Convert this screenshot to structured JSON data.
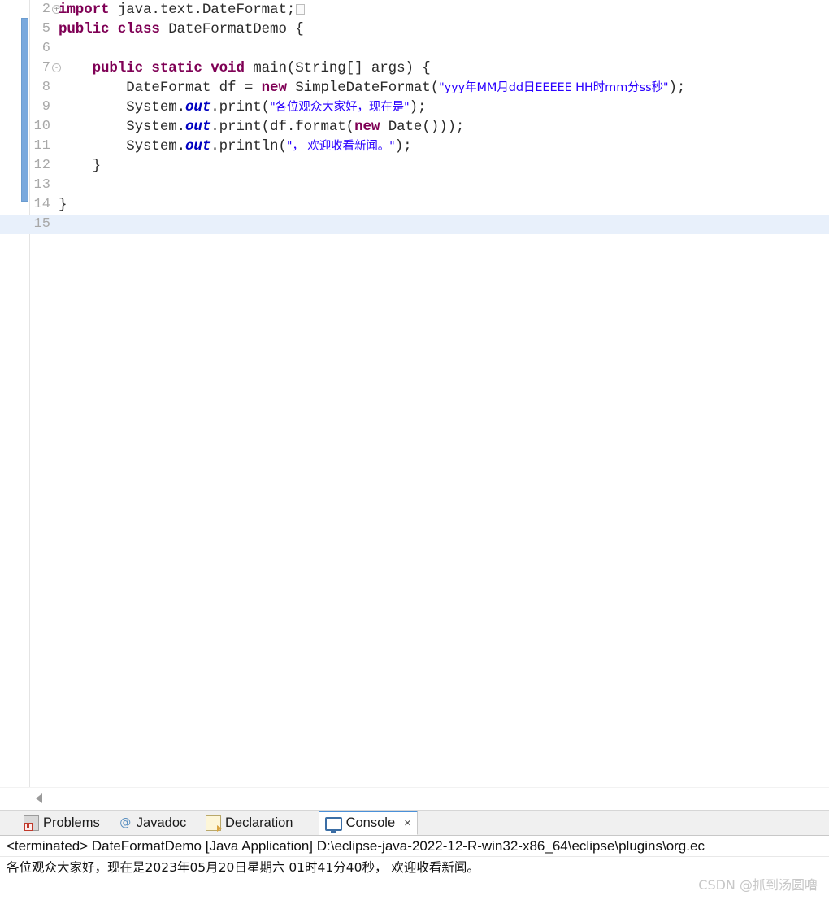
{
  "editor": {
    "lines": [
      {
        "num": "2",
        "fold": "+",
        "segments": [
          {
            "t": "import",
            "c": "kw"
          },
          {
            "t": " java.text.DateFormat;",
            "c": "plain"
          },
          {
            "t": "",
            "c": "foldbox"
          }
        ]
      },
      {
        "num": "5",
        "fold": "",
        "segments": [
          {
            "t": "public class",
            "c": "kw"
          },
          {
            "t": " DateFormatDemo {",
            "c": "plain"
          }
        ]
      },
      {
        "num": "6",
        "fold": "",
        "segments": []
      },
      {
        "num": "7",
        "fold": "-",
        "segments": [
          {
            "t": "    ",
            "c": "plain"
          },
          {
            "t": "public static void",
            "c": "kw"
          },
          {
            "t": " main(String[] args) {",
            "c": "plain"
          }
        ]
      },
      {
        "num": "8",
        "fold": "",
        "segments": [
          {
            "t": "        DateFormat df = ",
            "c": "plain"
          },
          {
            "t": "new",
            "c": "kw"
          },
          {
            "t": " SimpleDateFormat(",
            "c": "plain"
          },
          {
            "t": "\"yyy年MM月dd日EEEEE HH时mm分ss秒\"",
            "c": "str"
          },
          {
            "t": ");",
            "c": "plain"
          }
        ]
      },
      {
        "num": "9",
        "fold": "",
        "segments": [
          {
            "t": "        System.",
            "c": "plain"
          },
          {
            "t": "out",
            "c": "fld"
          },
          {
            "t": ".print(",
            "c": "plain"
          },
          {
            "t": "\"各位观众大家好，现在是\"",
            "c": "str"
          },
          {
            "t": ");",
            "c": "plain"
          }
        ]
      },
      {
        "num": "10",
        "fold": "",
        "segments": [
          {
            "t": "        System.",
            "c": "plain"
          },
          {
            "t": "out",
            "c": "fld"
          },
          {
            "t": ".print(df.format(",
            "c": "plain"
          },
          {
            "t": "new",
            "c": "kw"
          },
          {
            "t": " Date()));",
            "c": "plain"
          }
        ]
      },
      {
        "num": "11",
        "fold": "",
        "segments": [
          {
            "t": "        System.",
            "c": "plain"
          },
          {
            "t": "out",
            "c": "fld"
          },
          {
            "t": ".println(",
            "c": "plain"
          },
          {
            "t": "\"， 欢迎收看新闻。\"",
            "c": "str"
          },
          {
            "t": ");",
            "c": "plain"
          }
        ]
      },
      {
        "num": "12",
        "fold": "",
        "segments": [
          {
            "t": "    }",
            "c": "plain"
          }
        ]
      },
      {
        "num": "13",
        "fold": "",
        "segments": []
      },
      {
        "num": "14",
        "fold": "",
        "segments": [
          {
            "t": "}",
            "c": "plain"
          }
        ]
      },
      {
        "num": "15",
        "fold": "",
        "current": true,
        "segments": [
          {
            "t": "",
            "c": "caret"
          }
        ]
      }
    ],
    "colors": {
      "keyword": "#7f0055",
      "string": "#2a00ff",
      "static_field": "#0000c0",
      "plain": "#2b2b2b",
      "line_number": "#a8a8a8",
      "current_line_highlight": "#e8f0fb",
      "change_bar": "#7aa9dd"
    }
  },
  "scrollbar": {
    "left_arrow_icon": "triangle-left-icon"
  },
  "bottom_panel": {
    "tabs": [
      {
        "label": "Problems",
        "icon": "problems-icon",
        "active": false,
        "closable": false
      },
      {
        "label": "Javadoc",
        "icon": "javadoc-icon",
        "active": false,
        "closable": false
      },
      {
        "label": "Declaration",
        "icon": "declaration-icon",
        "active": false,
        "closable": false
      },
      {
        "label": "Console",
        "icon": "console-icon",
        "active": true,
        "closable": true,
        "close_glyph": "×"
      }
    ],
    "console": {
      "header": "<terminated> DateFormatDemo [Java Application] D:\\eclipse-java-2022-12-R-win32-x86_64\\eclipse\\plugins\\org.ec",
      "output": "各位观众大家好，现在是2023年05月20日星期六 01时41分40秒， 欢迎收看新闻。"
    }
  },
  "watermark": "CSDN @抓到汤圆噜"
}
